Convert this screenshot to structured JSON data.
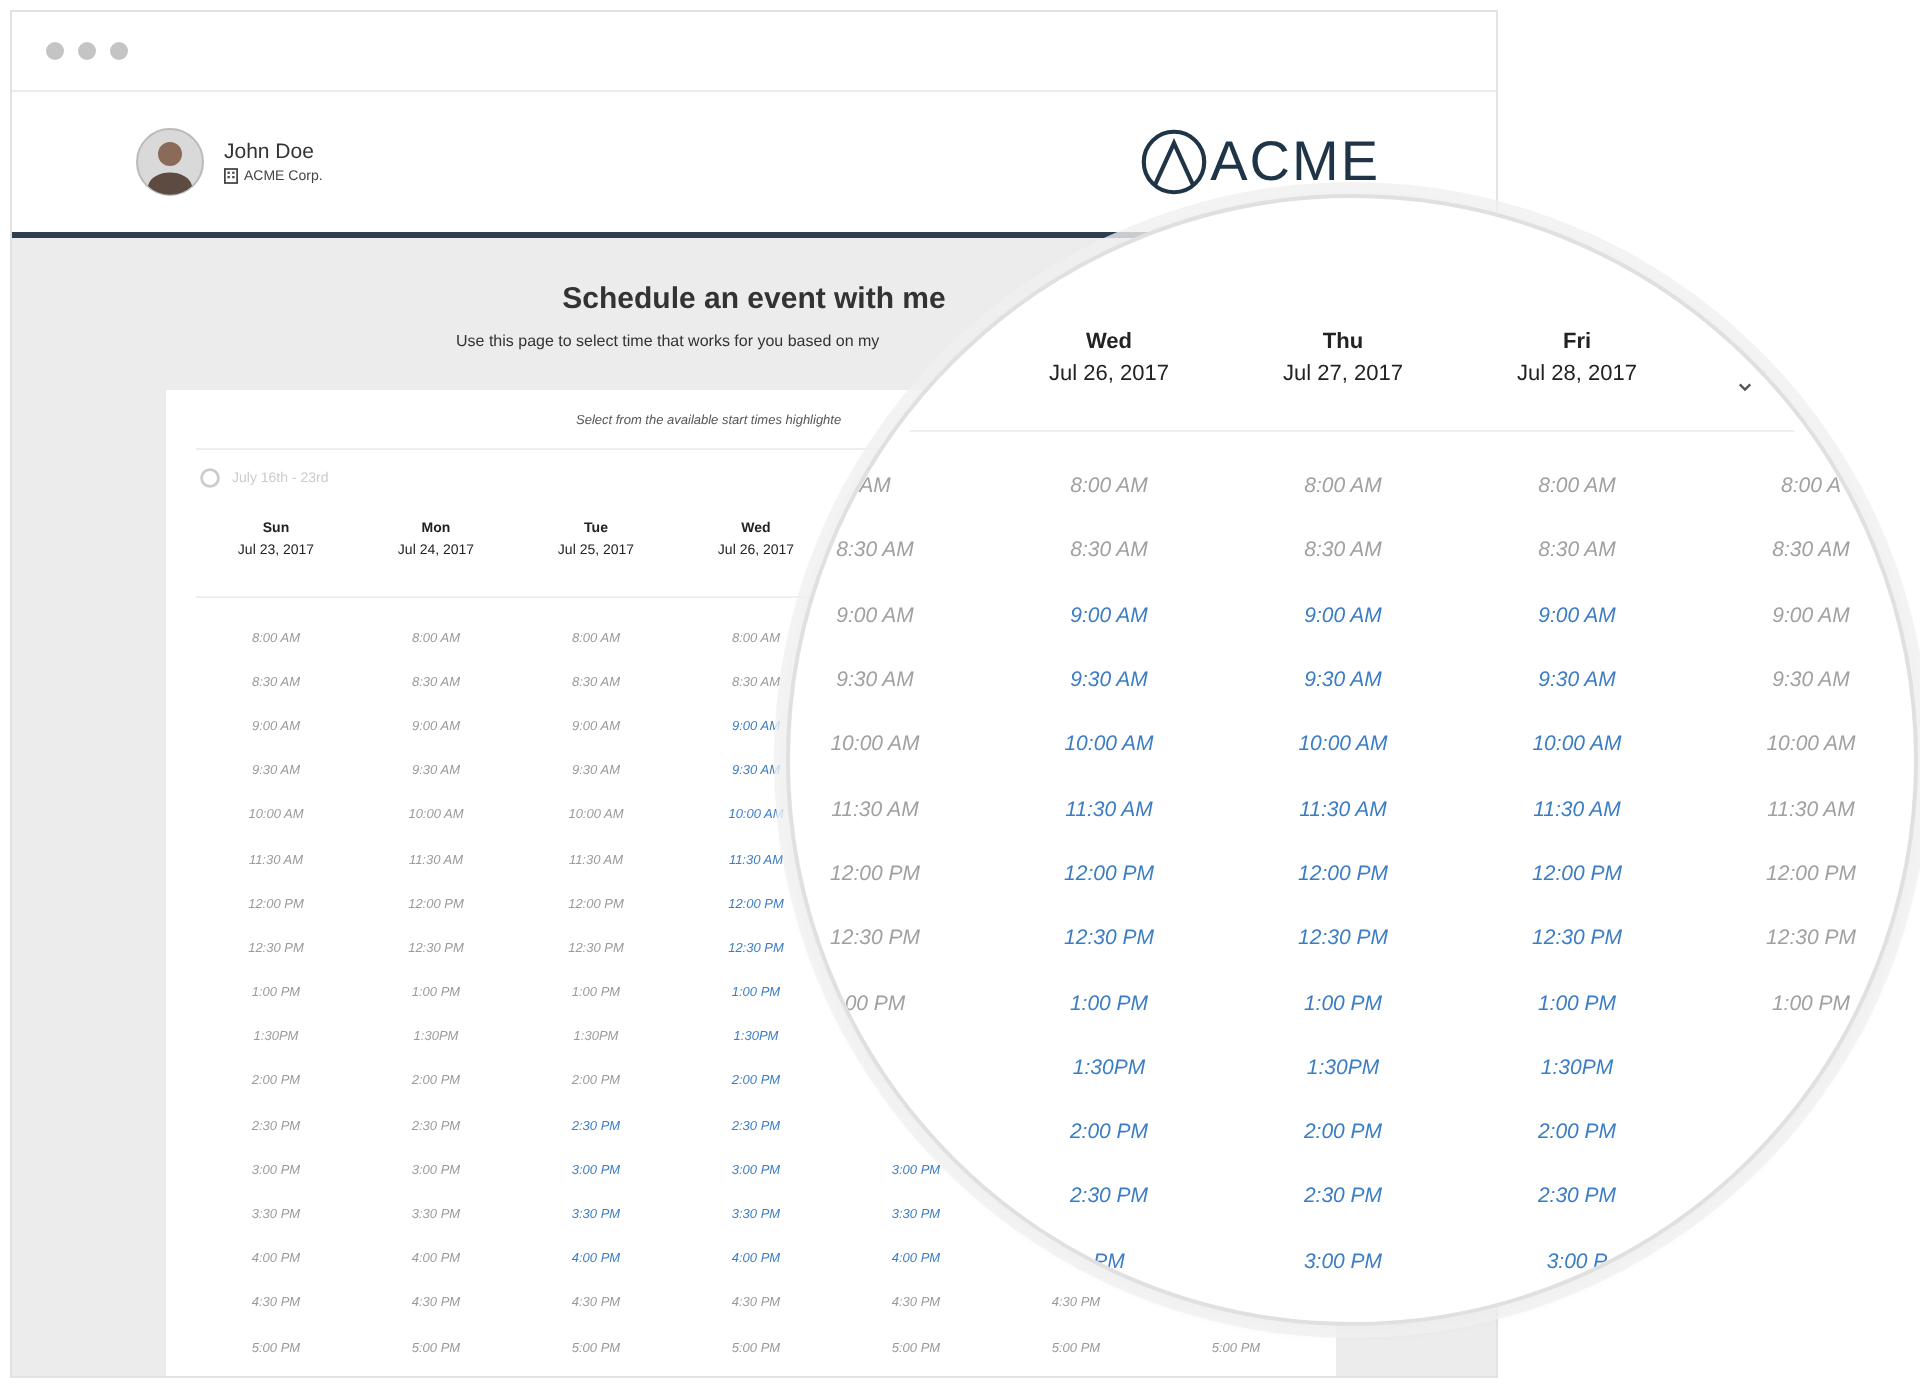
{
  "profile": {
    "name": "John Doe",
    "company": "ACME Corp."
  },
  "logo": {
    "text": "ACME"
  },
  "page": {
    "title": "Schedule an event with me",
    "subtitle": "Use this page to select time that works for you based on my"
  },
  "scheduler": {
    "hint": "Select from the available start times highlighte",
    "week_nav": "July 16th - 23rd",
    "days": [
      {
        "day": "Sun",
        "date": "Jul 23, 2017",
        "slots": [
          {
            "time": "8:00 AM",
            "available": false
          },
          {
            "time": "8:30 AM",
            "available": false
          },
          {
            "time": "9:00 AM",
            "available": false
          },
          {
            "time": "9:30 AM",
            "available": false
          },
          {
            "time": "10:00 AM",
            "available": false
          },
          {
            "time": "11:30 AM",
            "available": false
          },
          {
            "time": "12:00 PM",
            "available": false
          },
          {
            "time": "12:30 PM",
            "available": false
          },
          {
            "time": "1:00 PM",
            "available": false
          },
          {
            "time": "1:30PM",
            "available": false
          },
          {
            "time": "2:00 PM",
            "available": false
          },
          {
            "time": "2:30 PM",
            "available": false
          },
          {
            "time": "3:00 PM",
            "available": false
          },
          {
            "time": "3:30 PM",
            "available": false
          },
          {
            "time": "4:00 PM",
            "available": false
          },
          {
            "time": "4:30 PM",
            "available": false
          },
          {
            "time": "5:00 PM",
            "available": false
          }
        ]
      },
      {
        "day": "Mon",
        "date": "Jul 24, 2017",
        "slots": [
          {
            "time": "8:00 AM",
            "available": false
          },
          {
            "time": "8:30 AM",
            "available": false
          },
          {
            "time": "9:00 AM",
            "available": false
          },
          {
            "time": "9:30 AM",
            "available": false
          },
          {
            "time": "10:00 AM",
            "available": false
          },
          {
            "time": "11:30 AM",
            "available": false
          },
          {
            "time": "12:00 PM",
            "available": false
          },
          {
            "time": "12:30 PM",
            "available": false
          },
          {
            "time": "1:00 PM",
            "available": false
          },
          {
            "time": "1:30PM",
            "available": false
          },
          {
            "time": "2:00 PM",
            "available": false
          },
          {
            "time": "2:30 PM",
            "available": false
          },
          {
            "time": "3:00 PM",
            "available": false
          },
          {
            "time": "3:30 PM",
            "available": false
          },
          {
            "time": "4:00 PM",
            "available": false
          },
          {
            "time": "4:30 PM",
            "available": false
          },
          {
            "time": "5:00 PM",
            "available": false
          }
        ]
      },
      {
        "day": "Tue",
        "date": "Jul 25, 2017",
        "slots": [
          {
            "time": "8:00 AM",
            "available": false
          },
          {
            "time": "8:30 AM",
            "available": false
          },
          {
            "time": "9:00 AM",
            "available": false
          },
          {
            "time": "9:30 AM",
            "available": false
          },
          {
            "time": "10:00 AM",
            "available": false
          },
          {
            "time": "11:30 AM",
            "available": false
          },
          {
            "time": "12:00 PM",
            "available": false
          },
          {
            "time": "12:30 PM",
            "available": false
          },
          {
            "time": "1:00 PM",
            "available": false
          },
          {
            "time": "1:30PM",
            "available": false
          },
          {
            "time": "2:00 PM",
            "available": false
          },
          {
            "time": "2:30 PM",
            "available": true
          },
          {
            "time": "3:00 PM",
            "available": true
          },
          {
            "time": "3:30 PM",
            "available": true
          },
          {
            "time": "4:00 PM",
            "available": true
          },
          {
            "time": "4:30 PM",
            "available": false
          },
          {
            "time": "5:00 PM",
            "available": false
          }
        ]
      },
      {
        "day": "Wed",
        "date": "Jul 26, 2017",
        "slots": [
          {
            "time": "8:00 AM",
            "available": false
          },
          {
            "time": "8:30 AM",
            "available": false
          },
          {
            "time": "9:00 AM",
            "available": true
          },
          {
            "time": "9:30 AM",
            "available": true
          },
          {
            "time": "10:00 AM",
            "available": true
          },
          {
            "time": "11:30 AM",
            "available": true
          },
          {
            "time": "12:00 PM",
            "available": true
          },
          {
            "time": "12:30 PM",
            "available": true
          },
          {
            "time": "1:00 PM",
            "available": true
          },
          {
            "time": "1:30PM",
            "available": true
          },
          {
            "time": "2:00 PM",
            "available": true
          },
          {
            "time": "2:30 PM",
            "available": true
          },
          {
            "time": "3:00 PM",
            "available": true
          },
          {
            "time": "3:30 PM",
            "available": true
          },
          {
            "time": "4:00 PM",
            "available": true
          },
          {
            "time": "4:30 PM",
            "available": false
          },
          {
            "time": "5:00 PM",
            "available": false
          }
        ]
      },
      {
        "slots": [
          {
            "time": "3:00 PM",
            "available": true
          },
          {
            "time": "3:30 PM",
            "available": true
          },
          {
            "time": "4:00 PM",
            "available": true
          },
          {
            "time": "4:30 PM",
            "available": false
          },
          {
            "time": "5:00 PM",
            "available": false
          }
        ]
      },
      {
        "slots": [
          {
            "time": "4:30 PM",
            "available": false
          },
          {
            "time": "5:00 PM",
            "available": false
          }
        ]
      },
      {
        "slots": [
          {
            "time": "5:00 PM",
            "available": false
          }
        ]
      }
    ]
  },
  "magnifier": {
    "days": [
      {
        "slots": [
          {
            "time": "AM",
            "available": false
          },
          {
            "time": "8:30 AM",
            "available": false
          },
          {
            "time": "9:00 AM",
            "available": false
          },
          {
            "time": "9:30 AM",
            "available": false
          },
          {
            "time": "10:00 AM",
            "available": false
          },
          {
            "time": "11:30 AM",
            "available": false
          },
          {
            "time": "12:00 PM",
            "available": false
          },
          {
            "time": "12:30 PM",
            "available": false
          },
          {
            "time": "00 PM",
            "available": false
          }
        ]
      },
      {
        "day": "Wed",
        "date": "Jul 26, 2017",
        "slots": [
          {
            "time": "8:00 AM",
            "available": false
          },
          {
            "time": "8:30 AM",
            "available": false
          },
          {
            "time": "9:00 AM",
            "available": true
          },
          {
            "time": "9:30 AM",
            "available": true
          },
          {
            "time": "10:00 AM",
            "available": true
          },
          {
            "time": "11:30 AM",
            "available": true
          },
          {
            "time": "12:00 PM",
            "available": true
          },
          {
            "time": "12:30 PM",
            "available": true
          },
          {
            "time": "1:00 PM",
            "available": true
          },
          {
            "time": "1:30PM",
            "available": true
          },
          {
            "time": "2:00 PM",
            "available": true
          },
          {
            "time": "2:30 PM",
            "available": true
          },
          {
            "time": "PM",
            "available": true
          }
        ]
      },
      {
        "day": "Thu",
        "date": "Jul 27, 2017",
        "slots": [
          {
            "time": "8:00 AM",
            "available": false
          },
          {
            "time": "8:30 AM",
            "available": false
          },
          {
            "time": "9:00 AM",
            "available": true
          },
          {
            "time": "9:30 AM",
            "available": true
          },
          {
            "time": "10:00 AM",
            "available": true
          },
          {
            "time": "11:30 AM",
            "available": true
          },
          {
            "time": "12:00 PM",
            "available": true
          },
          {
            "time": "12:30 PM",
            "available": true
          },
          {
            "time": "1:00 PM",
            "available": true
          },
          {
            "time": "1:30PM",
            "available": true
          },
          {
            "time": "2:00 PM",
            "available": true
          },
          {
            "time": "2:30 PM",
            "available": true
          },
          {
            "time": "3:00 PM",
            "available": true
          }
        ]
      },
      {
        "day": "Fri",
        "date": "Jul 28, 2017",
        "slots": [
          {
            "time": "8:00 AM",
            "available": false
          },
          {
            "time": "8:30 AM",
            "available": false
          },
          {
            "time": "9:00 AM",
            "available": true
          },
          {
            "time": "9:30 AM",
            "available": true
          },
          {
            "time": "10:00 AM",
            "available": true
          },
          {
            "time": "11:30 AM",
            "available": true
          },
          {
            "time": "12:00 PM",
            "available": true
          },
          {
            "time": "12:30 PM",
            "available": true
          },
          {
            "time": "1:00 PM",
            "available": true
          },
          {
            "time": "1:30PM",
            "available": true
          },
          {
            "time": "2:00 PM",
            "available": true
          },
          {
            "time": "2:30 PM",
            "available": true
          },
          {
            "time": "3:00 P",
            "available": true
          }
        ]
      },
      {
        "slots": [
          {
            "time": "8:00 A",
            "available": false
          },
          {
            "time": "8:30 AM",
            "available": false
          },
          {
            "time": "9:00 AM",
            "available": false
          },
          {
            "time": "9:30 AM",
            "available": false
          },
          {
            "time": "10:00 AM",
            "available": false
          },
          {
            "time": "11:30 AM",
            "available": false
          },
          {
            "time": "12:00 PM",
            "available": false
          },
          {
            "time": "12:30 PM",
            "available": false
          },
          {
            "time": "1:00 PM",
            "available": false
          }
        ]
      }
    ]
  }
}
